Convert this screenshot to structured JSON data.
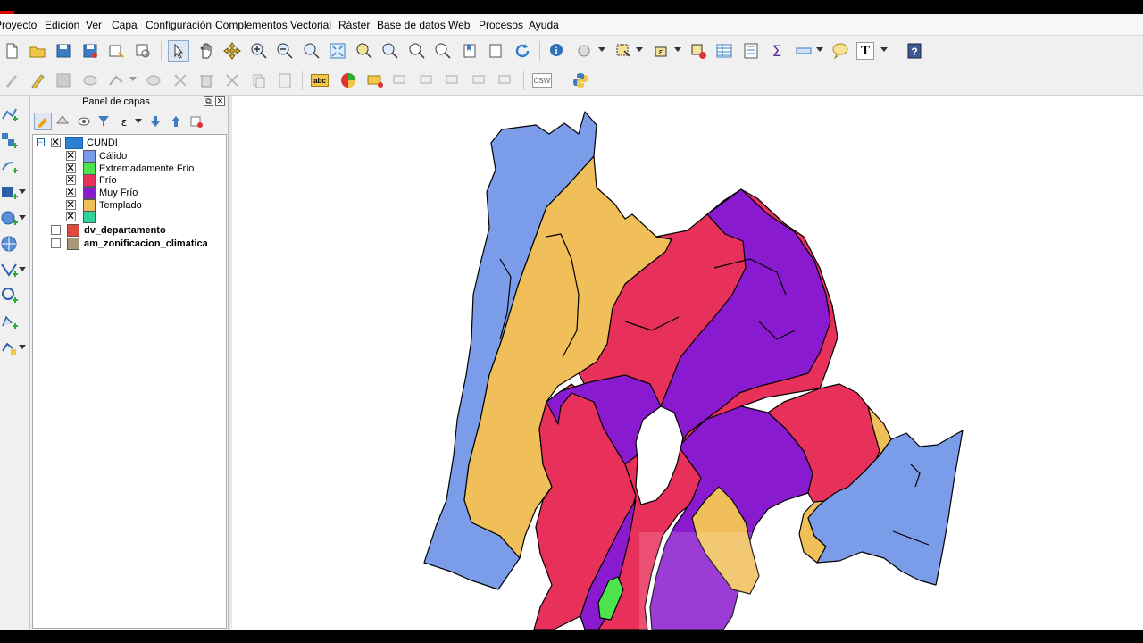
{
  "menu": [
    "Proyecto",
    "Edición",
    "Ver",
    "Capa",
    "Configuración",
    "Complementos",
    "Vectorial",
    "Ráster",
    "Base de datos",
    "Web",
    "Procesos",
    "Ayuda"
  ],
  "panel": {
    "title": "Panel de capas",
    "layers": [
      {
        "name": "CUNDI",
        "checked": true,
        "expanded": true,
        "classes": [
          {
            "label": "Cálido",
            "color": "#7b9ce8",
            "checked": true
          },
          {
            "label": "Extremadamente Frío",
            "color": "#4ce34c",
            "checked": true
          },
          {
            "label": "Frío",
            "color": "#e8315a",
            "checked": true
          },
          {
            "label": "Muy Frío",
            "color": "#8a1ad0",
            "checked": true
          },
          {
            "label": "Templado",
            "color": "#f0bf5a",
            "checked": true
          },
          {
            "label": "",
            "color": "#2fd39a",
            "checked": true
          }
        ]
      },
      {
        "name": "dv_departamento",
        "color": "#e04a3a",
        "checked": false
      },
      {
        "name": "am_zonificacion_climatica",
        "color": "#a89a78",
        "checked": false
      }
    ]
  },
  "toolbar": {
    "text_tool_label": "T",
    "csw_label": "CSW",
    "abc_label": "abc"
  },
  "map": {
    "colors": {
      "calido": "#7b9ce8",
      "extremadamente_frio": "#4ce34c",
      "frio": "#e8315a",
      "muy_frio": "#8a1ad0",
      "templado": "#f0bf5a"
    }
  }
}
